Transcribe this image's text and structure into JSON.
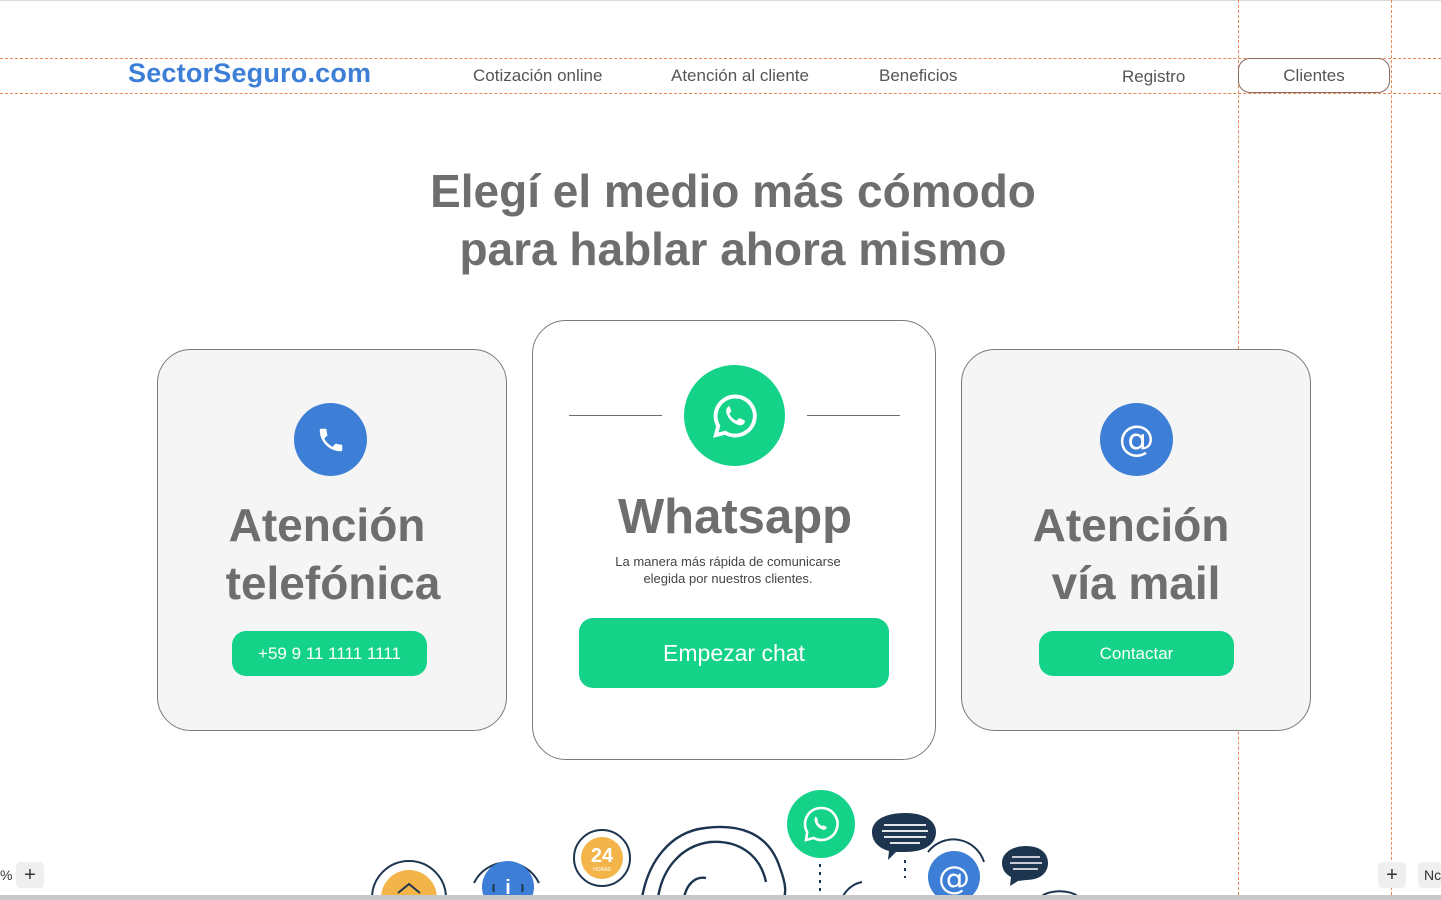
{
  "header": {
    "logo": "SectorSeguro.com",
    "nav": [
      "Cotización online",
      "Atención al cliente",
      "Beneficios"
    ],
    "register": "Registro",
    "clients": "Clientes"
  },
  "hero": {
    "line1": "Elegí el medio más cómodo",
    "line2": "para hablar ahora mismo"
  },
  "cards": {
    "phone": {
      "title_line1": "Atención",
      "title_line2": "telefónica",
      "button": "+59 9 11 1111 1111",
      "icon": "phone-icon"
    },
    "whatsapp": {
      "title": "Whatsapp",
      "subtitle_line1": "La manera más rápida de comunicarse",
      "subtitle_line2": "elegida por nuestros clientes.",
      "button": "Empezar chat",
      "icon": "whatsapp-icon"
    },
    "mail": {
      "title_line1": "Atención",
      "title_line2": "vía mail",
      "button": "Contactar",
      "icon": "at-icon"
    }
  },
  "illustration": {
    "badge_number": "24",
    "badge_label": "HORAS"
  },
  "canvas_controls": {
    "zoom_left": "%",
    "plus": "+",
    "right_label": "Nc"
  },
  "colors": {
    "brand_blue": "#3d7fd6",
    "whatsapp_green": "#14d288",
    "icon_blue": "#3d7fd6",
    "text_gray": "#6e6e6e",
    "guide_orange": "#e8875a"
  }
}
